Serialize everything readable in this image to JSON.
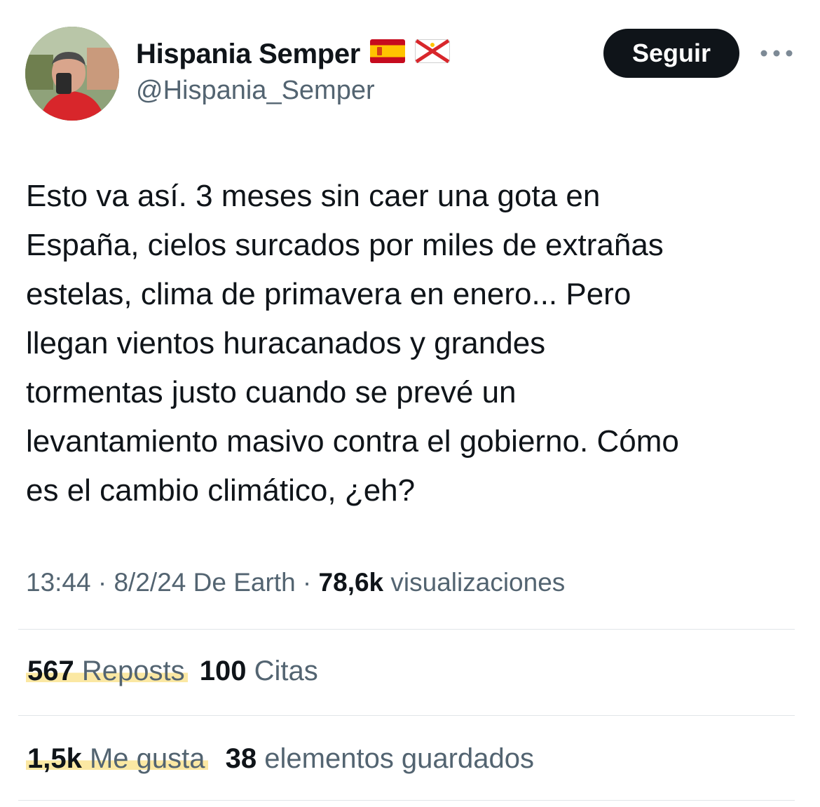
{
  "author": {
    "display_name": "Hispania Semper",
    "handle": "@Hispania_Semper",
    "flags": [
      "spain-flag-icon",
      "jersey-flag-icon"
    ]
  },
  "actions": {
    "follow_label": "Seguir",
    "more_icon": "more-dots-icon"
  },
  "tweet": {
    "text": "Esto va así. 3 meses sin caer una gota en\nEspaña, cielos surcados por miles de extrañas\nestelas, clima de primavera en enero... Pero\nllegan vientos huracanados y grandes\ntormentas justo cuando se prevé un\nlevantamiento masivo contra el gobierno. Cómo\nes el cambio climático, ¿eh?",
    "time": "13:44",
    "date": "8/2/24",
    "source": "De Earth",
    "views_count": "78,6k",
    "views_label": "visualizaciones"
  },
  "stats": {
    "reposts_count": "567",
    "reposts_label": "Reposts",
    "quotes_count": "100",
    "quotes_label": "Citas",
    "likes_count": "1,5k",
    "likes_label": "Me gusta",
    "bookmarks_count": "38",
    "bookmarks_label": "elementos guardados"
  },
  "colors": {
    "text": "#0f1419",
    "secondary": "#536471",
    "button_bg": "#0f1419",
    "highlight": "#fbe8a3",
    "divider": "#e1e5e8"
  }
}
